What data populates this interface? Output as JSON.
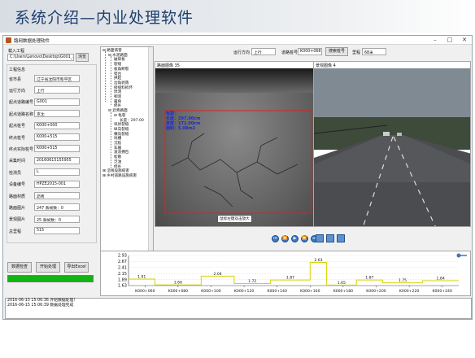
{
  "slide": {
    "title": "系统介绍—内业处理软件"
  },
  "window": {
    "title": "路网数据处理软件",
    "controls": [
      "–",
      "□",
      "✕"
    ]
  },
  "left_panel": {
    "import_label": "载入工程",
    "import_path": "C:\\Users\\Lenovo\\Desktop\\G001_20",
    "browse_label": "浏览",
    "project_info_label": "工程信息",
    "fields": [
      {
        "label": "省市县",
        "value": "辽宁省沈阳市和平区"
      },
      {
        "label": "运行方向",
        "value": "上行"
      },
      {
        "label": "起点道路编号",
        "value": "G001"
      },
      {
        "label": "起点道路名称",
        "value": "京沈"
      },
      {
        "label": "起点桩号",
        "value": "K000+000"
      },
      {
        "label": "终点桩号",
        "value": "K000+515"
      },
      {
        "label": "终点实际桩号",
        "value": "K000+515"
      },
      {
        "label": "采集时间",
        "value": "20160615155955"
      },
      {
        "label": "检测员",
        "value": "L"
      },
      {
        "label": "设备编号",
        "value": "HPZE2015-001"
      },
      {
        "label": "路面材质",
        "value": "沥青"
      },
      {
        "label": "路面图片",
        "value": "247   丢帧数：0"
      },
      {
        "label": "景观图片",
        "value": "25   丢帧数：0"
      },
      {
        "label": "总里程",
        "value": "515"
      }
    ],
    "buttons": {
      "check": "数据检查",
      "start": "开始处理",
      "export": "导出Excel"
    },
    "progress": 1.0
  },
  "tree": {
    "nodes": [
      {
        "text": "⊟ 路面病害",
        "level": 0
      },
      {
        "text": "⊟ 水泥路面",
        "level": 1
      },
      {
        "text": "破碎板",
        "level": 2
      },
      {
        "text": "裂缝",
        "level": 2
      },
      {
        "text": "板角断裂",
        "level": 2
      },
      {
        "text": "错台",
        "level": 2
      },
      {
        "text": "拱起",
        "level": 2
      },
      {
        "text": "边角剥落",
        "level": 2
      },
      {
        "text": "接缝料损坏",
        "level": 2
      },
      {
        "text": "坑洞",
        "level": 2
      },
      {
        "text": "唧泥",
        "level": 2
      },
      {
        "text": "露骨",
        "level": 2
      },
      {
        "text": "修补",
        "level": 2
      },
      {
        "text": "⊟ 沥青路面",
        "level": 1
      },
      {
        "text": "⊟ 龟裂",
        "level": 2
      },
      {
        "text": "长度：297.00",
        "level": 3
      },
      {
        "text": "块状裂缝",
        "level": 2
      },
      {
        "text": "纵向裂缝",
        "level": 2
      },
      {
        "text": "横向裂缝",
        "level": 2
      },
      {
        "text": "坑槽",
        "level": 2
      },
      {
        "text": "沉陷",
        "level": 2
      },
      {
        "text": "车辙",
        "level": 2
      },
      {
        "text": "波浪拥包",
        "level": 2
      },
      {
        "text": "松散",
        "level": 2
      },
      {
        "text": "泛油",
        "level": 2
      },
      {
        "text": "修补",
        "level": 2
      },
      {
        "text": "⊞ 沿线设施病害",
        "level": 0
      },
      {
        "text": "⊞ 乡村道路设施病害",
        "level": 0
      }
    ]
  },
  "toolbar": {
    "direction_label": "运行方向",
    "direction_value": "上行",
    "stake_label": "道路桩号",
    "stake_value": "K000+068",
    "search_label": "搜索桩号",
    "mileage_label": "里程",
    "mileage_value": "68米"
  },
  "road_pane": {
    "header": "路面图像 35",
    "annotation": [
      "龟裂：",
      "长度：297.00cm",
      "宽度：171.00cm",
      "面积：5.08m2"
    ],
    "tooltip": "鼠标左键双击放大"
  },
  "landscape_pane": {
    "header": "景观图像 4"
  },
  "media_controls": [
    "⏮",
    "⏪",
    "▶",
    "⏩",
    "⏭"
  ],
  "chart_data": {
    "type": "line",
    "categories": [
      "K000+060",
      "K000+080",
      "K000+100",
      "K000+120",
      "K000+140",
      "K000+160",
      "K000+180",
      "K000+200",
      "K000+220",
      "K000+240"
    ],
    "y_ticks": [
      "2.93",
      "2.67",
      "2.41",
      "2.15",
      "1.89",
      "1.63"
    ],
    "ylim": [
      1.63,
      2.93
    ],
    "steps": [
      {
        "x0": 0,
        "x1": 0.8,
        "value": 1.91,
        "label": "1.91"
      },
      {
        "x0": 0.8,
        "x1": 2.2,
        "value": 1.66,
        "label": "1.66"
      },
      {
        "x0": 2.2,
        "x1": 3.2,
        "value": 2.04,
        "label": "2.04"
      },
      {
        "x0": 3.2,
        "x1": 4.3,
        "value": 1.72,
        "label": "1.72"
      },
      {
        "x0": 4.3,
        "x1": 5.5,
        "value": 1.87,
        "label": "1.87"
      },
      {
        "x0": 5.5,
        "x1": 6.0,
        "value": 2.63,
        "label": "2.63"
      },
      {
        "x0": 6.0,
        "x1": 6.9,
        "value": 1.65,
        "label": "1.65"
      },
      {
        "x0": 6.9,
        "x1": 7.7,
        "value": 1.87,
        "label": "1.87"
      },
      {
        "x0": 7.7,
        "x1": 8.9,
        "value": 1.75,
        "label": "1.75"
      },
      {
        "x0": 8.9,
        "x1": 10,
        "value": 1.84,
        "label": "1.84"
      }
    ],
    "side_buttons": [
      "+",
      "−",
      "⟲"
    ]
  },
  "log": {
    "lines": [
      "2016-06-15 15:06:36  开始数据处理!",
      "2016-06-15 15:06:39  数据处理完成"
    ]
  },
  "colors": {
    "accent": "#3a77c0",
    "progress": "#12b312",
    "step": "#d4d400"
  }
}
